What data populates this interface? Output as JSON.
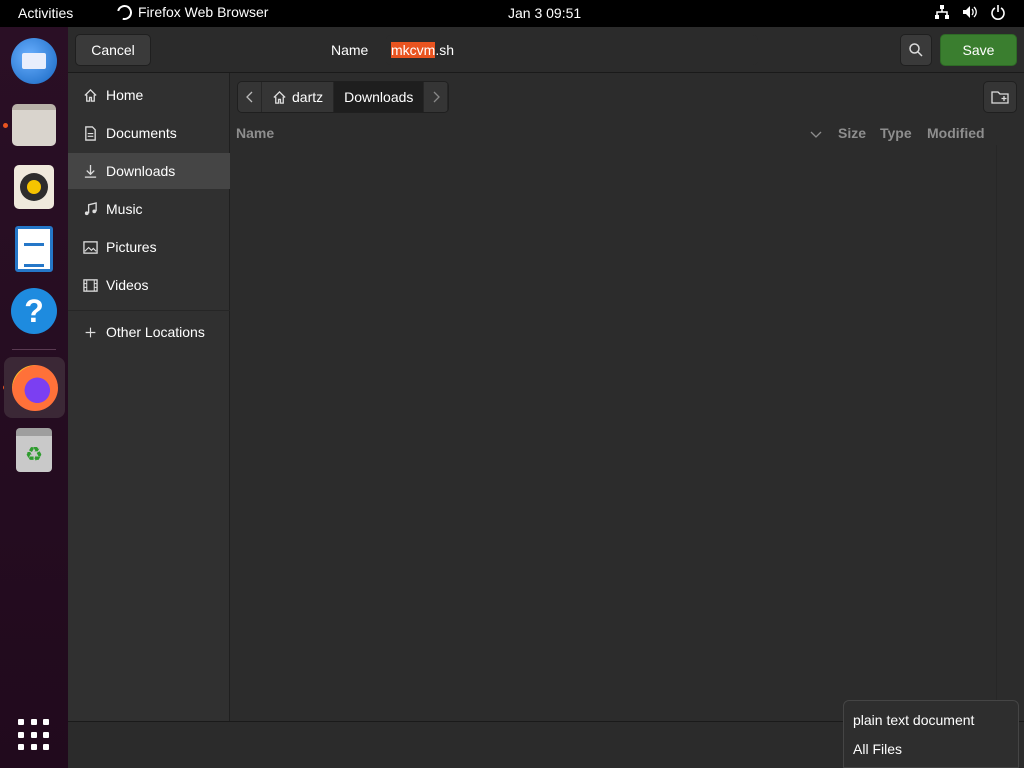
{
  "topbar": {
    "activities": "Activities",
    "app_name": "Firefox Web Browser",
    "clock": "Jan 3  09:51",
    "tray_icons": [
      "network-icon",
      "volume-icon",
      "power-icon"
    ]
  },
  "dock": {
    "items": [
      "thunderbird",
      "files",
      "rhythmbox",
      "libreoffice-writer",
      "help",
      "firefox",
      "trash"
    ],
    "help_glyph": "?",
    "trash_glyph": "♻"
  },
  "dialog": {
    "cancel_label": "Cancel",
    "name_label": "Name",
    "filename_selected": "mkcvm",
    "filename_ext": ".sh",
    "save_label": "Save"
  },
  "sidebar": {
    "items": [
      {
        "label": "Home",
        "icon": "home-icon"
      },
      {
        "label": "Documents",
        "icon": "document-icon"
      },
      {
        "label": "Downloads",
        "icon": "download-icon",
        "selected": true
      },
      {
        "label": "Music",
        "icon": "music-icon"
      },
      {
        "label": "Pictures",
        "icon": "picture-icon"
      },
      {
        "label": "Videos",
        "icon": "video-icon"
      },
      {
        "label": "Other Locations",
        "icon": "plus-icon"
      }
    ]
  },
  "pathbar": {
    "crumbs": [
      "dartz",
      "Downloads"
    ]
  },
  "columns": {
    "name": "Name",
    "size": "Size",
    "type": "Type",
    "modified": "Modified"
  },
  "filter_popup": {
    "options": [
      "plain text document",
      "All Files"
    ]
  },
  "colors": {
    "accent": "#e95420",
    "save_green": "#3a7e2f",
    "dock_bg": "#2a0f25"
  }
}
